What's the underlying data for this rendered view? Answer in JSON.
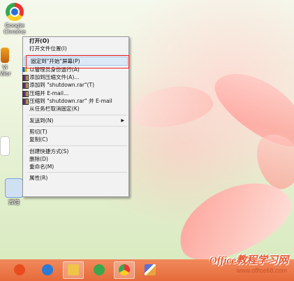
{
  "desktop": {
    "icons": [
      {
        "label": "Google Chrome",
        "icon": "chrome-icon"
      },
      {
        "label": "Vi",
        "icon": "app-icon"
      },
      {
        "label": "Wor",
        "icon": "app-icon"
      },
      {
        "label": "宾馆",
        "icon": "app-icon"
      }
    ]
  },
  "context_menu": {
    "items": [
      {
        "label": "打开(O)",
        "bold": true
      },
      {
        "label": "打开文件位置(I)"
      },
      {
        "label": "固定到\"开始\"屏幕(P)",
        "highlighted": true
      },
      {
        "label": "以管理员身份运行(A)",
        "icon": "uac-shield-icon"
      },
      {
        "label": "添加到压缩文件(A)...",
        "icon": "winrar-icon"
      },
      {
        "label": "添加到 \"shutdown.rar\"(T)",
        "icon": "winrar-icon"
      },
      {
        "label": "压缩并 E-mail...",
        "icon": "winrar-icon"
      },
      {
        "label": "压缩到 \"shutdown.rar\" 并 E-mail",
        "icon": "winrar-icon"
      },
      {
        "label": "从任务栏取消固定(K)"
      },
      {
        "label": "发送到(N)",
        "submenu": true
      },
      {
        "label": "剪切(T)"
      },
      {
        "label": "复制(C)"
      },
      {
        "label": "创建快捷方式(S)"
      },
      {
        "label": "删除(D)"
      },
      {
        "label": "重命名(M)"
      },
      {
        "label": "属性(R)"
      }
    ],
    "submenu_arrow": "▶"
  },
  "taskbar": {
    "buttons": [
      {
        "name": "shutdown-taskbar-button",
        "icon": "power-icon",
        "color": "#e84c1f"
      },
      {
        "name": "ie-taskbar-button",
        "icon": "internet-explorer-icon",
        "color": "#2a7ad6"
      },
      {
        "name": "file-explorer-taskbar-button",
        "icon": "folder-icon",
        "color": "#f0c44a"
      },
      {
        "name": "sync-taskbar-button",
        "icon": "sync-icon",
        "color": "#3aa84a"
      },
      {
        "name": "chrome-taskbar-button",
        "icon": "chrome-icon",
        "color": "#e33"
      },
      {
        "name": "pen-taskbar-button",
        "icon": "pen-icon",
        "color": "#5b6fd6"
      }
    ]
  },
  "watermark": {
    "title": "Office教程学习网",
    "url": "www.office68.com"
  }
}
